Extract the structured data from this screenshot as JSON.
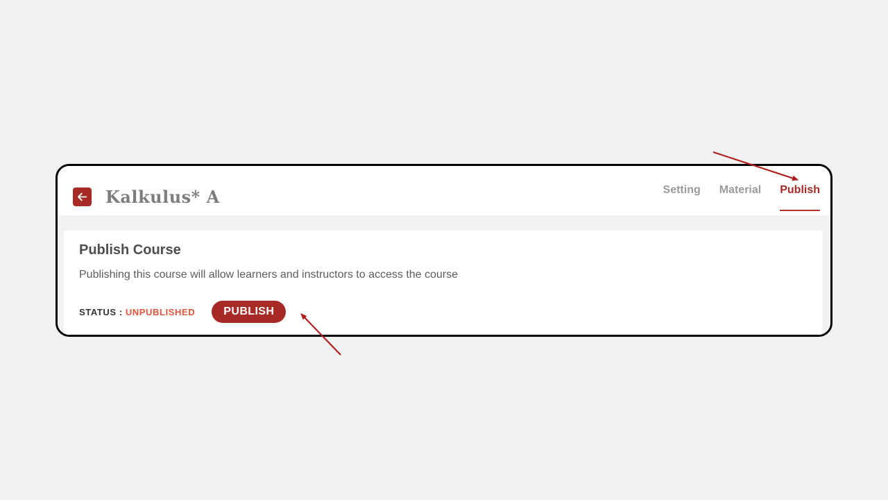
{
  "header": {
    "back_icon": "arrow-left-icon",
    "course_title": "Kalkulus* A",
    "tabs": [
      {
        "label": "Setting",
        "active": false
      },
      {
        "label": "Material",
        "active": false
      },
      {
        "label": "Publish",
        "active": true
      }
    ]
  },
  "publish_section": {
    "title": "Publish Course",
    "description": "Publishing this course will allow learners and instructors to access the course",
    "status_label": "STATUS :",
    "status_value": "UNPUBLISHED",
    "publish_button_label": "PUBLISH"
  },
  "colors": {
    "accent": "#a82a26",
    "status_unpublished": "#e4553c",
    "annotation_arrow": "#b01e1e",
    "frame_border": "#000000",
    "page_background": "#f1f1f1"
  }
}
